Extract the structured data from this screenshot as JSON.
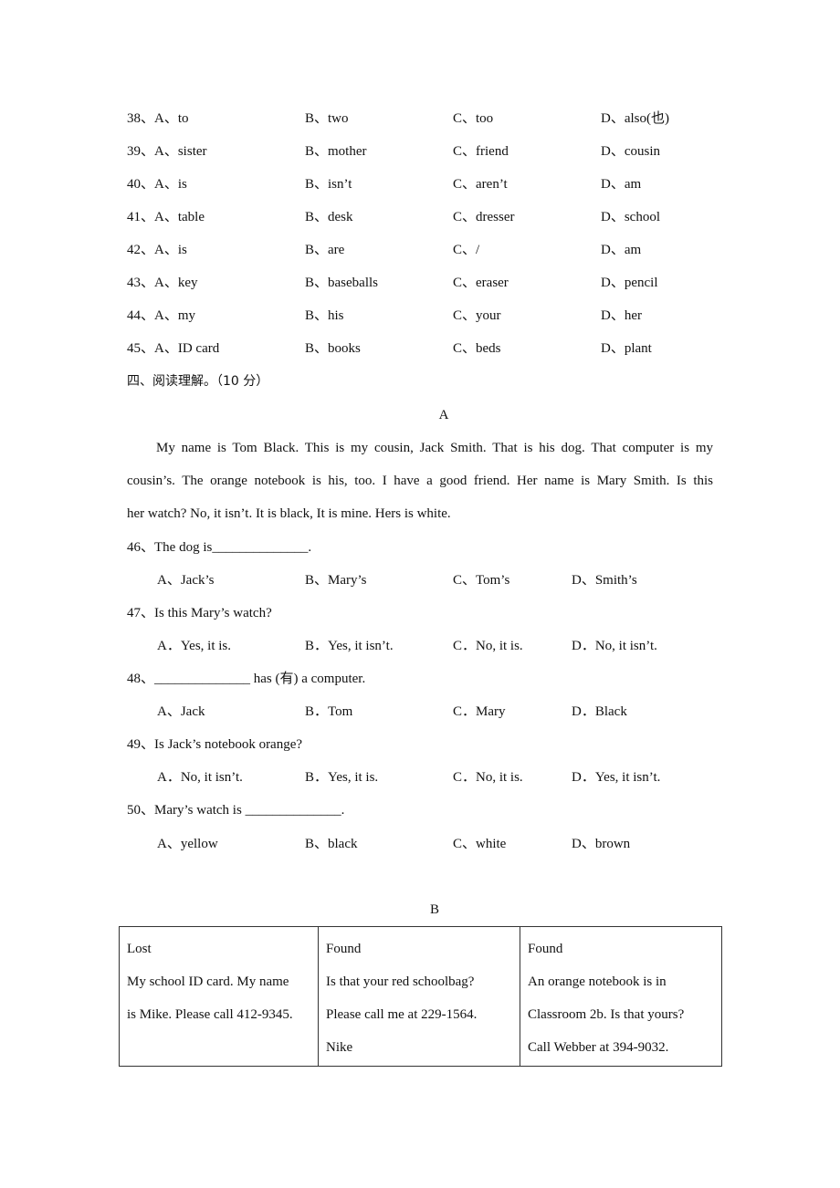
{
  "cloze_options": [
    {
      "num": "38、",
      "A": "A、to",
      "B": "B、two",
      "C": "C、too",
      "D": "D、also(也)"
    },
    {
      "num": "39、",
      "A": "A、sister",
      "B": "B、mother",
      "C": "C、friend",
      "D": "D、cousin"
    },
    {
      "num": "40、",
      "A": "A、is",
      "B": "B、isn’t",
      "C": "C、aren’t",
      "D": "D、am"
    },
    {
      "num": "41、",
      "A": "A、table",
      "B": "B、desk",
      "C": "C、dresser",
      "D": "D、school"
    },
    {
      "num": "42、",
      "A": "A、is",
      "B": "B、are",
      "C": "C、/",
      "D": "D、am"
    },
    {
      "num": "43、",
      "A": "A、key",
      "B": "B、baseballs",
      "C": "C、eraser",
      "D": "D、pencil"
    },
    {
      "num": "44、",
      "A": "A、my",
      "B": "B、his",
      "C": "C、your",
      "D": "D、her"
    },
    {
      "num": "45、",
      "A": "A、ID card",
      "B": "B、books",
      "C": "C、beds",
      "D": "D、plant"
    }
  ],
  "section_four": {
    "title": "四、阅读理解。（10 分）"
  },
  "passage_a": {
    "label": "A",
    "lines": [
      "My name is Tom Black. This is my cousin, Jack Smith. That is his dog. That computer is my",
      "cousin’s. The orange notebook is his, too. I have a good friend. Her name is Mary Smith. Is this",
      "her watch? No, it isn’t. It is black, It is mine. Hers is white."
    ]
  },
  "questions": [
    {
      "stem": "46、The dog is______________.",
      "A": "A、Jack’s",
      "B": "B、Mary’s",
      "C": "C、Tom’s",
      "D": "D、Smith’s"
    },
    {
      "stem": "47、Is this Mary’s watch?",
      "A": "A．Yes, it is.",
      "B": "B．Yes, it isn’t.",
      "C": "C．No, it is.",
      "D": "D．No, it isn’t."
    },
    {
      "stem": "48、______________ has (有) a computer.",
      "A": "A、Jack",
      "B": "B．Tom",
      "C": "C．Mary",
      "D": "D．Black"
    },
    {
      "stem": "49、Is Jack’s notebook orange?",
      "A": "A．No, it isn’t.",
      "B": "B．Yes, it is.",
      "C": "C．No, it is.",
      "D": "D．Yes, it isn’t."
    },
    {
      "stem": "50、Mary’s watch is ______________.",
      "A": "A、yellow",
      "B": "B、black",
      "C": "C、white",
      "D": "D、brown"
    }
  ],
  "passage_b": {
    "label": "B",
    "notices": [
      {
        "heading": "Lost",
        "lines": [
          "My school ID card. My name",
          "is Mike. Please call 412-9345."
        ]
      },
      {
        "heading": "Found",
        "lines": [
          "Is that your red schoolbag?",
          "Please call me at 229-1564.",
          "Nike"
        ]
      },
      {
        "heading": "Found",
        "lines": [
          "An orange notebook is in",
          "Classroom 2b. Is that yours?",
          "Call Webber at 394-9032."
        ]
      }
    ]
  }
}
